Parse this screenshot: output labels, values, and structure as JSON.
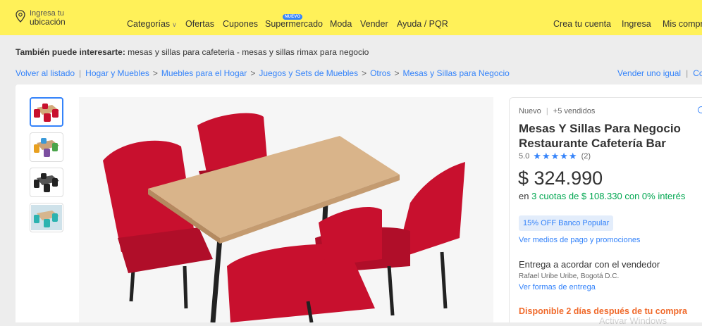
{
  "header": {
    "location_small": "Ingresa tu",
    "location_big": "ubicación",
    "nav": [
      "Categorías",
      "Ofertas",
      "Cupones",
      "Supermercado",
      "Moda",
      "Vender",
      "Ayuda / PQR"
    ],
    "new_badge": "NUEVO",
    "account": [
      "Crea tu cuenta",
      "Ingresa",
      "Mis compras"
    ]
  },
  "suggestion": {
    "label": "También puede interesarte:",
    "text": "mesas y sillas para cafeteria - mesas y sillas rimax para negocio"
  },
  "breadcrumb": {
    "back": "Volver al listado",
    "items": [
      "Hogar y Muebles",
      "Muebles para el Hogar",
      "Juegos y Sets de Muebles",
      "Otros",
      "Mesas y Sillas para Negocio"
    ],
    "sell_similar": "Vender uno igual",
    "share_cut": "Co"
  },
  "product": {
    "condition": "Nuevo",
    "sold": "+5 vendidos",
    "title": "Mesas Y Sillas Para Negocio Restaurante Cafetería Bar",
    "rating": "5.0",
    "stars": "★★★★★",
    "reviews": "(2)",
    "price": "$ 324.990",
    "installments_prefix": "en ",
    "installments": "3 cuotas de $ 108.330 con 0% interés",
    "promo": "15% OFF Banco Popular",
    "payment_link": "Ver medios de pago y promociones",
    "delivery": "Entrega a acordar con el vendedor",
    "address": "Rafael Uribe Uribe, Bogotá D.C.",
    "delivery_link": "Ver formas de entrega",
    "availability": "Disponible 2 días después de tu compra"
  },
  "watermark": "Activar Windows",
  "colors": {
    "header_bg": "#fff159",
    "link": "#3483fa",
    "price_green": "#00a650",
    "availability": "#f06a2b",
    "chair_red": "#c8102e"
  }
}
